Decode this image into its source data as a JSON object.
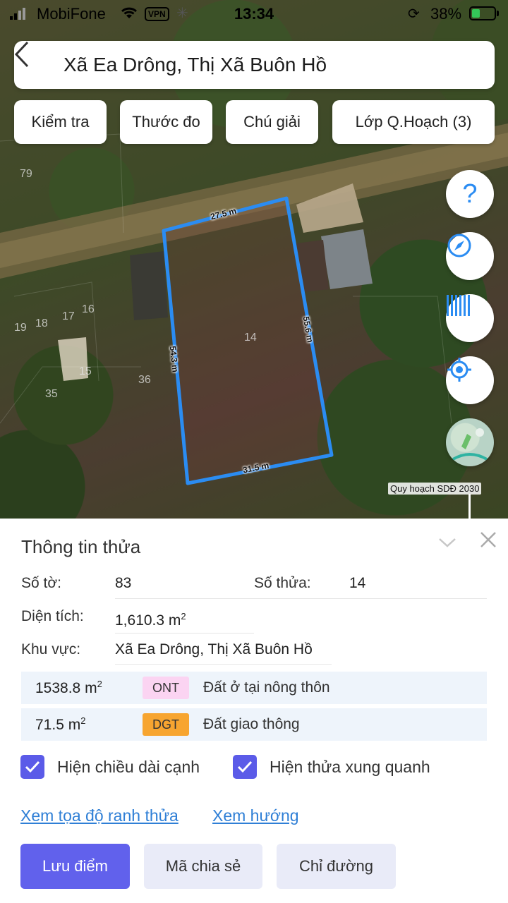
{
  "status_bar": {
    "carrier": "MobiFone",
    "vpn": "VPN",
    "time": "13:34",
    "battery_percent": "38%",
    "battery_level": 0.38
  },
  "header": {
    "title": "Xã Ea Drông, Thị Xã Buôn Hồ",
    "back_icon": "chevron-left-icon"
  },
  "chips": [
    "Kiểm tra",
    "Thước đo",
    "Chú giải",
    "Lớp Q.Hoạch (3)"
  ],
  "map": {
    "parcel_numbers": [
      "79",
      "19",
      "18",
      "17",
      "16",
      "15",
      "35",
      "36",
      "14"
    ],
    "edges": [
      "27.5 m",
      "55.6 m",
      "54.3 m",
      "31.5 m"
    ],
    "layer_caption": "Quy hoạch SDĐ 2030",
    "fab_icons": [
      "help-icon",
      "compass-icon",
      "barcode-icon",
      "locate-icon",
      "map-layer-icon"
    ],
    "help_symbol": "?",
    "highlight_color": "#2b8cf2"
  },
  "info": {
    "title": "Thông tin thửa",
    "so_to_label": "Số tờ:",
    "so_to_value": "83",
    "so_thua_label": "Số thửa:",
    "so_thua_value": "14",
    "dien_tich_label": "Diện tích:",
    "dien_tich_value": "1,610.3 m",
    "dien_tich_sup": "2",
    "khu_vuc_label": "Khu vực:",
    "khu_vuc_value": "Xã Ea Drông, Thị Xã Buôn Hồ"
  },
  "land_use": [
    {
      "area": "1538.8 m",
      "sup": "2",
      "code": "ONT",
      "code_color": "#fbd4f2",
      "desc": "Đất ở tại nông thôn"
    },
    {
      "area": "71.5 m",
      "sup": "2",
      "code": "DGT",
      "code_color": "#f7a530",
      "desc": "Đất giao thông"
    }
  ],
  "options": {
    "show_edge_length": "Hiện chiều dài cạnh",
    "show_neighbors": "Hiện thửa xung quanh"
  },
  "links": {
    "coords": "Xem tọa độ ranh thửa",
    "direction": "Xem hướng"
  },
  "buttons": {
    "save": "Lưu điểm",
    "share": "Mã chia sẻ",
    "route": "Chỉ đường"
  },
  "colors": {
    "accent": "#6161ec",
    "link": "#2f7fd6"
  }
}
